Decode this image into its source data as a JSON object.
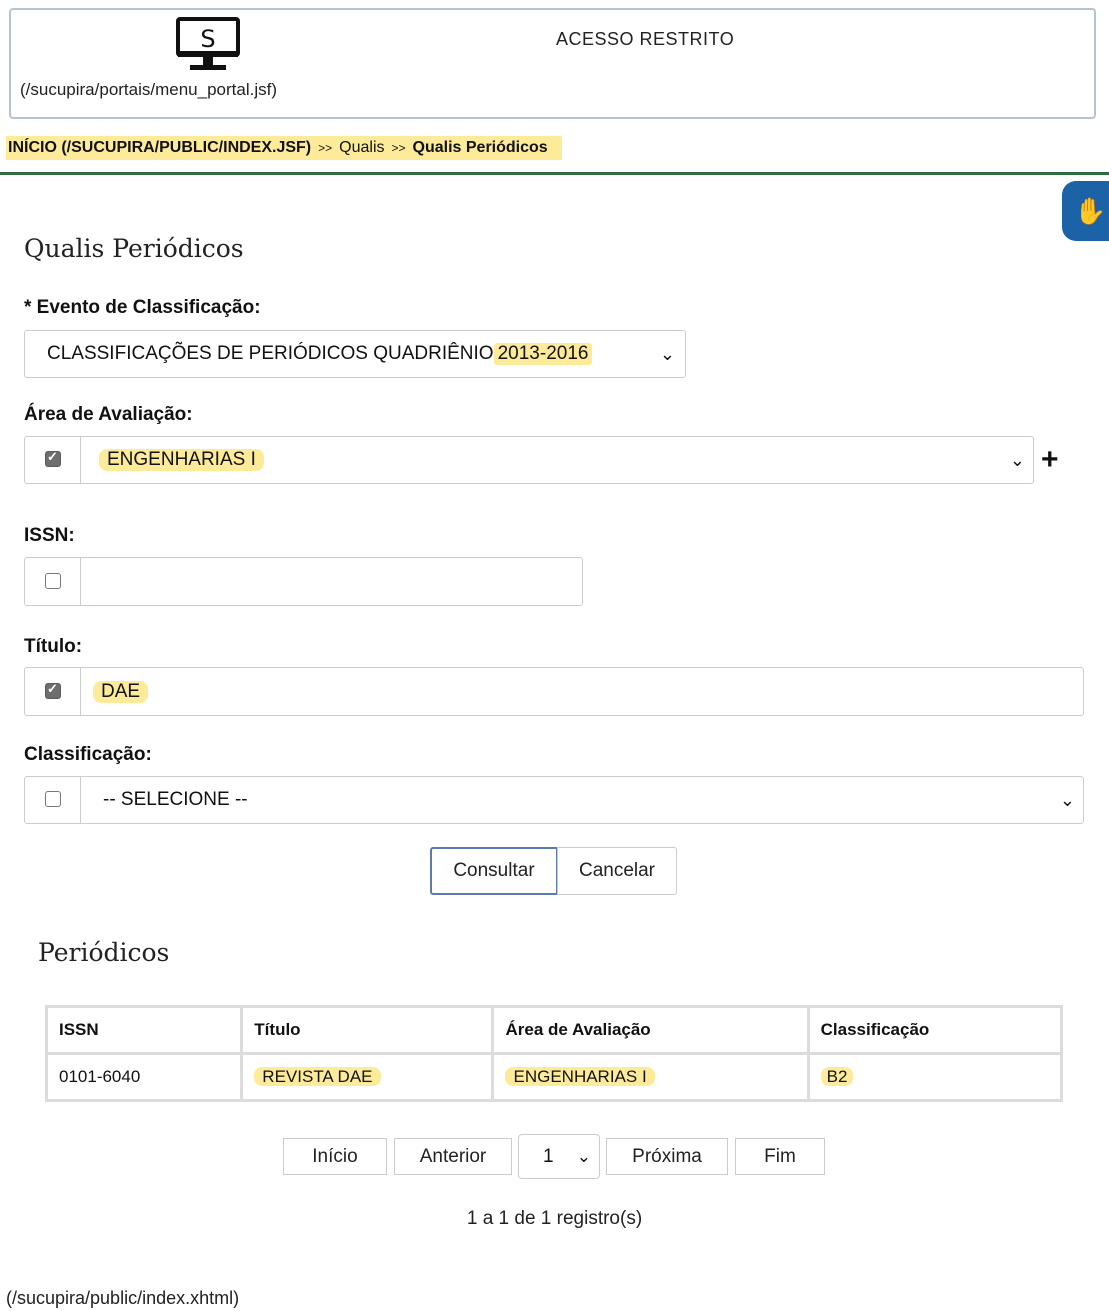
{
  "header": {
    "logo_letter": "S",
    "portal_link": "(/sucupira/portais/menu_portal.jsf)",
    "restricted_label": "ACESSO RESTRITO"
  },
  "breadcrumb": {
    "home": "INÍCIO (/SUCUPIRA/PUBLIC/INDEX.JSF)",
    "separator": ">>",
    "level1": "Qualis",
    "current": "Qualis Periódicos"
  },
  "accessibility_icon": "sign-language-hand-icon",
  "page_title": "Qualis Periódicos",
  "form": {
    "evento": {
      "label": "* Evento de Classificação:",
      "value_prefix": "CLASSIFICAÇÕES DE PERIÓDICOS QUADRIÊNIO ",
      "value_highlight": "2013-2016"
    },
    "area": {
      "label": "Área de Avaliação:",
      "checked": true,
      "value": "ENGENHARIAS I",
      "add_label": "+"
    },
    "issn": {
      "label": "ISSN:",
      "checked": false,
      "value": ""
    },
    "titulo": {
      "label": "Título:",
      "checked": true,
      "value": "DAE"
    },
    "classificacao": {
      "label": "Classificação:",
      "checked": false,
      "value": "-- SELECIONE --"
    },
    "consultar_label": "Consultar",
    "cancelar_label": "Cancelar"
  },
  "results": {
    "title": "Periódicos",
    "columns": [
      "ISSN",
      "Título",
      "Área de Avaliação",
      "Classificação"
    ],
    "rows": [
      {
        "issn": "0101-6040",
        "titulo": "REVISTA DAE",
        "area": "ENGENHARIAS I",
        "classificacao": "B2"
      }
    ]
  },
  "pagination": {
    "first": "Início",
    "prev": "Anterior",
    "page": "1",
    "next": "Próxima",
    "last": "Fim",
    "summary": "1 a 1 de 1 registro(s)"
  },
  "footer": {
    "link": "(/sucupira/public/index.xhtml)"
  }
}
